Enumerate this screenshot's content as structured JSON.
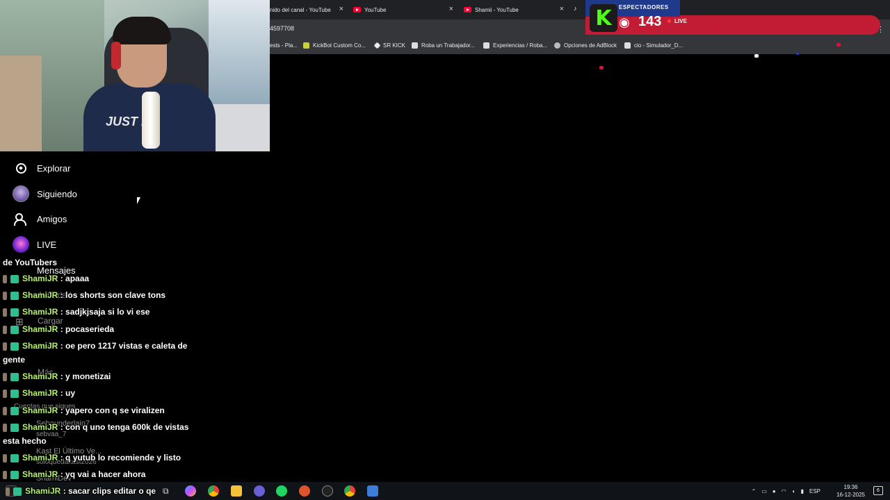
{
  "browser": {
    "tabs": [
      {
        "label": "nido del canal - YouTube"
      },
      {
        "label": "YouTube"
      },
      {
        "label": "Shamii - YouTube"
      }
    ],
    "address": "4597708",
    "bookmarks": [
      {
        "label": "ests - Pla..."
      },
      {
        "label": "KickBot Custom Co..."
      },
      {
        "label": "SR KICK"
      },
      {
        "label": "Roba un Trabajador..."
      },
      {
        "label": "Experiencias / Roba..."
      },
      {
        "label": "Opciones de AdBlock"
      },
      {
        "label": "cio - Simulador_D..."
      }
    ]
  },
  "kick_overlay": {
    "logo": "K",
    "label": "ESPECTADORES",
    "viewers": "143",
    "live": "LIVE"
  },
  "webcam": {
    "shirt_text": "JUST DO"
  },
  "sidebar": {
    "items": [
      {
        "label": "Explorar",
        "icon": "compass-icon"
      },
      {
        "label": "Siguiendo",
        "icon": "avatar-icon"
      },
      {
        "label": "Amigos",
        "icon": "friends-icon"
      },
      {
        "label": "LIVE",
        "icon": "live-icon"
      },
      {
        "label": "Mensajes"
      }
    ],
    "ghost": {
      "actividad": "Actividad",
      "cargar": "Cargar",
      "perfil": "Perfil",
      "mas": "Más",
      "cuentas": "Cuentas que sigues",
      "f1": "Sebaunderlain7",
      "f1b": "sebvaa_7",
      "f2": "Kast El Último Ve...",
      "f2b": "soloquedakast2026",
      "f3": "ShamiDev"
    }
  },
  "chat": {
    "top_fragment": "de YouTubers",
    "messages": [
      {
        "user": "ShamiJR",
        "text": ": apaaa"
      },
      {
        "user": "ShamiJR",
        "text": ": los shorts son clave tons"
      },
      {
        "user": "ShamiJR",
        "text": ": sadjkjsaja si lo vi ese"
      },
      {
        "user": "ShamiJR",
        "text": ": pocaserieda"
      },
      {
        "user": "ShamiJR",
        "text": ": oe pero 1217 vistas e caleta de",
        "wrap": "gente"
      },
      {
        "user": "ShamiJR",
        "text": ": y monetizai"
      },
      {
        "user": "ShamiJR",
        "text": ": uy"
      },
      {
        "user": "ShamiJR",
        "text": ": yapero con q se viralizen"
      },
      {
        "user": "ShamiJR",
        "text": ": con q uno tenga 600k de vistas",
        "wrap": "esta hecho"
      },
      {
        "user": "ShamiJR",
        "text": ": q yutub lo recomiende y listo"
      },
      {
        "user": "ShamiJR",
        "text": ": yq vai a hacer ahora"
      },
      {
        "user": "ShamiJR",
        "text": ": sacar clips editar o qe"
      }
    ]
  },
  "taskbar": {
    "lang": "ESP",
    "time": "19:36",
    "date": "16-12-2025",
    "notifications": "6"
  }
}
